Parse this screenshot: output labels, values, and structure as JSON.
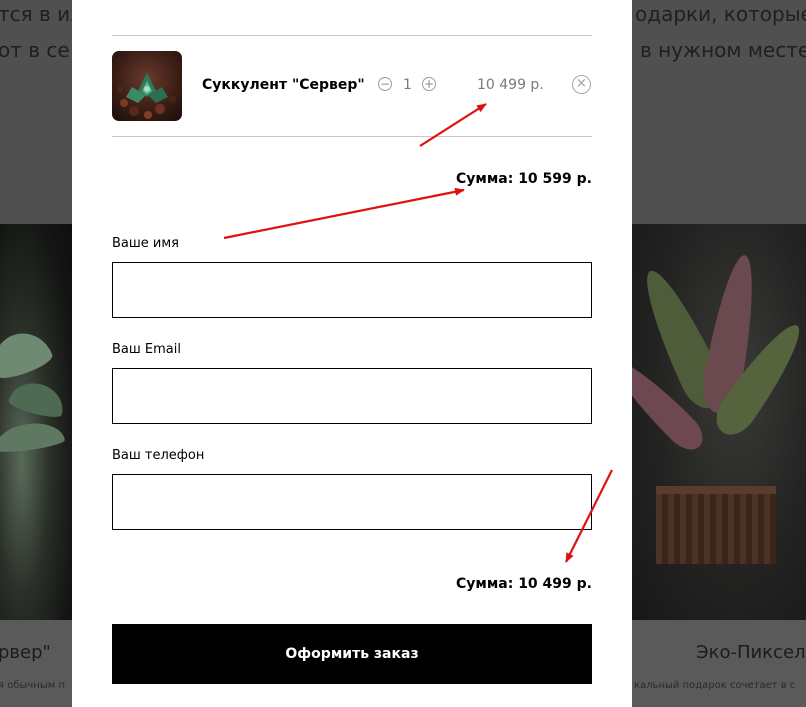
{
  "background": {
    "text_left_top": "тся в из",
    "text_left_mid": "от в се",
    "text_right_top": "одарки, которые",
    "text_right_mid": "в нужном месте",
    "caption_left": "рвер\"",
    "caption_right": "Эко-Пиксель",
    "small_left": "я обычным п",
    "small_right": "кальный подарок сочетает в с"
  },
  "cart": {
    "item": {
      "name": "Суккулент \"Сервер\"",
      "quantity": "1",
      "price": "10 499 р."
    },
    "sum_top": "Сумма: 10 599 р.",
    "sum_bottom": "Сумма: 10 499 р."
  },
  "form": {
    "name_label": "Ваше имя",
    "email_label": "Ваш Email",
    "phone_label": "Ваш телефон",
    "name_value": "",
    "email_value": "",
    "phone_value": "",
    "submit_label": "Оформить заказ"
  },
  "icons": {
    "minus": "minus-circle-icon",
    "plus": "plus-circle-icon",
    "remove": "close-circle-icon"
  },
  "colors": {
    "accent_arrow": "#e01010",
    "button_bg": "#000000",
    "overlay": "#505050"
  }
}
